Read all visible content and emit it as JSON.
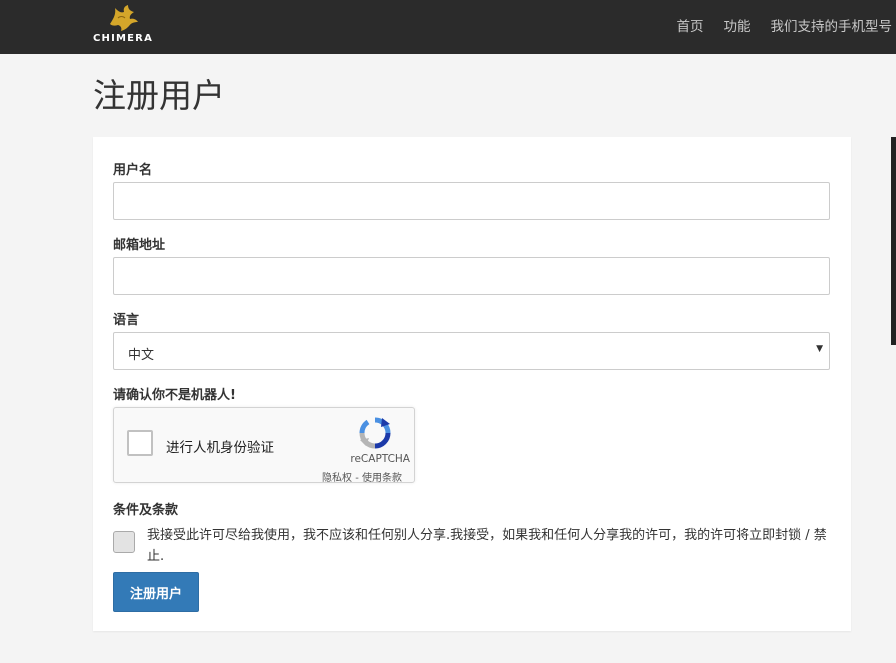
{
  "header": {
    "logo_text": "CHIMERA",
    "nav": [
      {
        "label": "首页"
      },
      {
        "label": "功能"
      },
      {
        "label": "我们支持的手机型号"
      }
    ]
  },
  "page": {
    "title": "注册用户"
  },
  "form": {
    "username_label": "用户名",
    "username_value": "",
    "email_label": "邮箱地址",
    "email_value": "",
    "language_label": "语言",
    "language_selected": "中文",
    "captcha_label": "请确认你不是机器人!",
    "terms_label": "条件及条款",
    "terms_text": "我接受此许可尽给我使用，我不应该和任何别人分享.我接受，如果我和任何人分享我的许可，我的许可将立即封锁 / 禁止.",
    "submit_label": "注册用户"
  },
  "recaptcha": {
    "checkbox_text": "进行人机身份验证",
    "brand": "reCAPTCHA",
    "links": "隐私权 - 使用条款"
  },
  "colors": {
    "header_bg": "#2b2b2b",
    "logo_gold": "#d4a62a",
    "primary_button": "#337ab7",
    "page_bg": "#f4f4f4"
  }
}
